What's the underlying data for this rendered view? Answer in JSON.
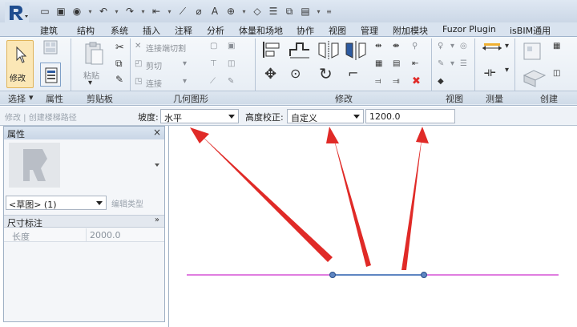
{
  "ribbon_tabs": [
    "建筑",
    "结构",
    "系统",
    "插入",
    "注释",
    "分析",
    "体量和场地",
    "协作",
    "视图",
    "管理",
    "附加模块",
    "Fuzor Plugin",
    "isBIM通用",
    "创建"
  ],
  "ribbon": {
    "select_label": "修改",
    "paste_label": "粘贴",
    "join_label": "连接端切割",
    "cut_label": "剪切",
    "join2_label": "连接",
    "panels": {
      "select": "选择",
      "properties": "属性",
      "clipboard": "剪贴板",
      "geometry": "几何图形",
      "modify": "修改",
      "view": "视图",
      "measure": "测量",
      "create": "创建"
    },
    "select_dropdown": "▾"
  },
  "options_bar": {
    "context_hint": "修改 | 创建楼梯路径",
    "slope_label": "坡度:",
    "slope_value": "水平",
    "height_label": "高度校正:",
    "height_value": "自定义",
    "height_input": "1200.0"
  },
  "properties": {
    "title": "属性",
    "close": "×",
    "type_selector": "<草图> (1)",
    "edit_type": "编辑类型",
    "group": "尺寸标注",
    "collapse": "»",
    "rows": [
      {
        "key": "长度",
        "value": "2000.0"
      }
    ]
  },
  "colors": {
    "accent_red": "#e02a27",
    "sketch_line": "#d653d6",
    "selected_segment": "#5f86c2"
  }
}
